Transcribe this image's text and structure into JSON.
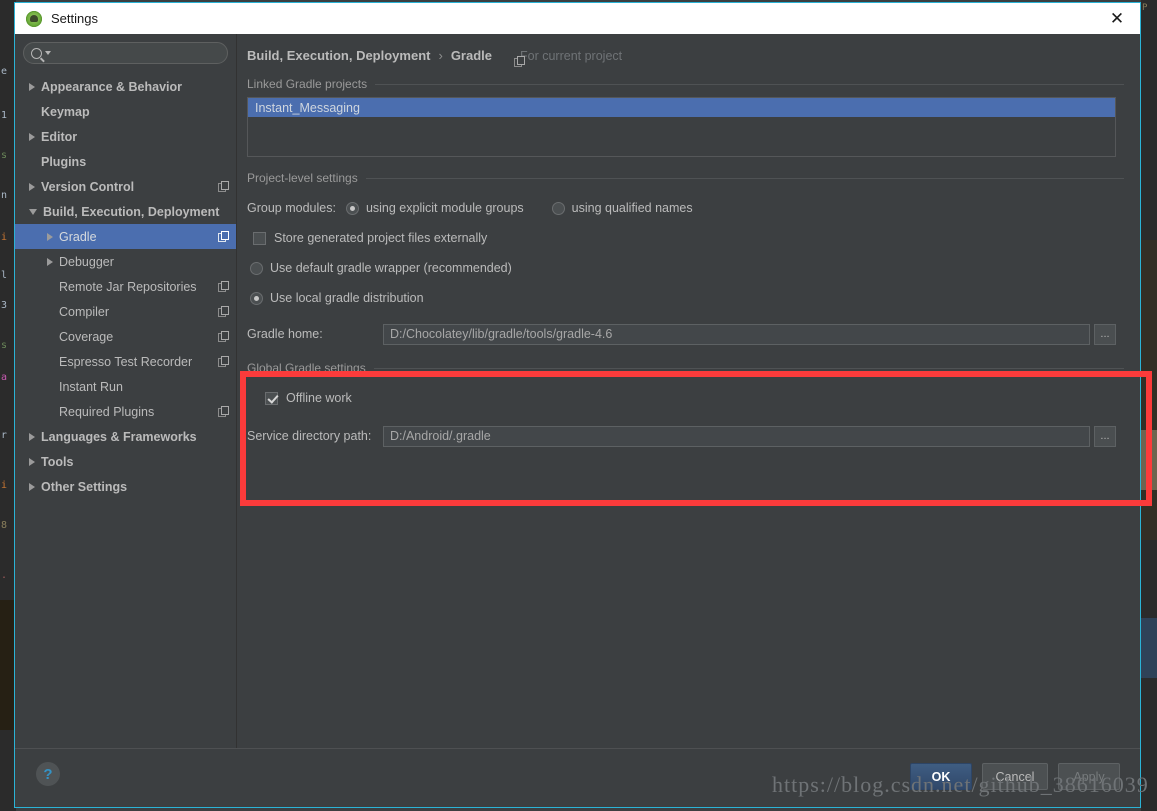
{
  "window": {
    "title": "Settings",
    "close_label": "✕",
    "app_icon": "android-studio-icon"
  },
  "search": {
    "value": "",
    "placeholder": ""
  },
  "sidebar": {
    "items": [
      {
        "label": "Appearance & Behavior",
        "arrow": "right",
        "indent": 0,
        "bold": true,
        "project_icon": false
      },
      {
        "label": "Keymap",
        "arrow": "none",
        "indent": 0,
        "bold": true,
        "project_icon": false
      },
      {
        "label": "Editor",
        "arrow": "right",
        "indent": 0,
        "bold": true,
        "project_icon": false
      },
      {
        "label": "Plugins",
        "arrow": "none",
        "indent": 0,
        "bold": true,
        "project_icon": false
      },
      {
        "label": "Version Control",
        "arrow": "right",
        "indent": 0,
        "bold": true,
        "project_icon": true
      },
      {
        "label": "Build, Execution, Deployment",
        "arrow": "down",
        "indent": 0,
        "bold": true,
        "project_icon": false
      },
      {
        "label": "Gradle",
        "arrow": "right",
        "indent": 1,
        "bold": false,
        "project_icon": true,
        "selected": true
      },
      {
        "label": "Debugger",
        "arrow": "right",
        "indent": 1,
        "bold": false,
        "project_icon": false
      },
      {
        "label": "Remote Jar Repositories",
        "arrow": "none",
        "indent": 1,
        "bold": false,
        "project_icon": true
      },
      {
        "label": "Compiler",
        "arrow": "none",
        "indent": 1,
        "bold": false,
        "project_icon": true
      },
      {
        "label": "Coverage",
        "arrow": "none",
        "indent": 1,
        "bold": false,
        "project_icon": true
      },
      {
        "label": "Espresso Test Recorder",
        "arrow": "none",
        "indent": 1,
        "bold": false,
        "project_icon": true
      },
      {
        "label": "Instant Run",
        "arrow": "none",
        "indent": 1,
        "bold": false,
        "project_icon": false
      },
      {
        "label": "Required Plugins",
        "arrow": "none",
        "indent": 1,
        "bold": false,
        "project_icon": true
      },
      {
        "label": "Languages & Frameworks",
        "arrow": "right",
        "indent": 0,
        "bold": true,
        "project_icon": false
      },
      {
        "label": "Tools",
        "arrow": "right",
        "indent": 0,
        "bold": true,
        "project_icon": false
      },
      {
        "label": "Other Settings",
        "arrow": "right",
        "indent": 0,
        "bold": true,
        "project_icon": false
      }
    ]
  },
  "content": {
    "breadcrumb": {
      "parent": "Build, Execution, Deployment",
      "separator": "›",
      "current": "Gradle",
      "scope_label": "For current project"
    },
    "linked_projects": {
      "section_label": "Linked Gradle projects",
      "selected_project": "Instant_Messaging"
    },
    "project_level": {
      "section_label": "Project-level settings",
      "group_modules_label": "Group modules:",
      "group_modules_options": [
        {
          "label": "using explicit module groups",
          "checked": true
        },
        {
          "label": "using qualified names",
          "checked": false
        }
      ],
      "store_externally": {
        "label": "Store generated project files externally",
        "checked": false
      },
      "distribution_options": [
        {
          "label": "Use default gradle wrapper (recommended)",
          "checked": false
        },
        {
          "label": "Use local gradle distribution",
          "checked": true
        }
      ],
      "gradle_home_label": "Gradle home:",
      "gradle_home_value": "D:/Chocolatey/lib/gradle/tools/gradle-4.6",
      "browse_label": "..."
    },
    "global_settings": {
      "section_label": "Global Gradle settings",
      "offline_work": {
        "label": "Offline work",
        "checked": true
      },
      "service_dir_label": "Service directory path:",
      "service_dir_value": "D:/Android/.gradle",
      "browse_label": "..."
    },
    "annotation": {
      "color": "#fb3b3b"
    }
  },
  "footer": {
    "help_label": "?",
    "ok_label": "OK",
    "cancel_label": "Cancel",
    "apply_label": "Apply"
  },
  "watermark": "https://blog.csdn.net/github_38616039",
  "background": {
    "right_text": "P",
    "left_code": [
      "e",
      "1",
      "s",
      "n",
      "i",
      "l",
      "3",
      "s",
      "a",
      "r",
      "i",
      "8",
      "."
    ]
  },
  "colors": {
    "accent_blue": "#4b6eaf",
    "annotation_red": "#fb3b3b",
    "dialog_bg": "#3c3f41",
    "border_cyan": "#2bb3d6",
    "help_blue": "#3592c4"
  }
}
